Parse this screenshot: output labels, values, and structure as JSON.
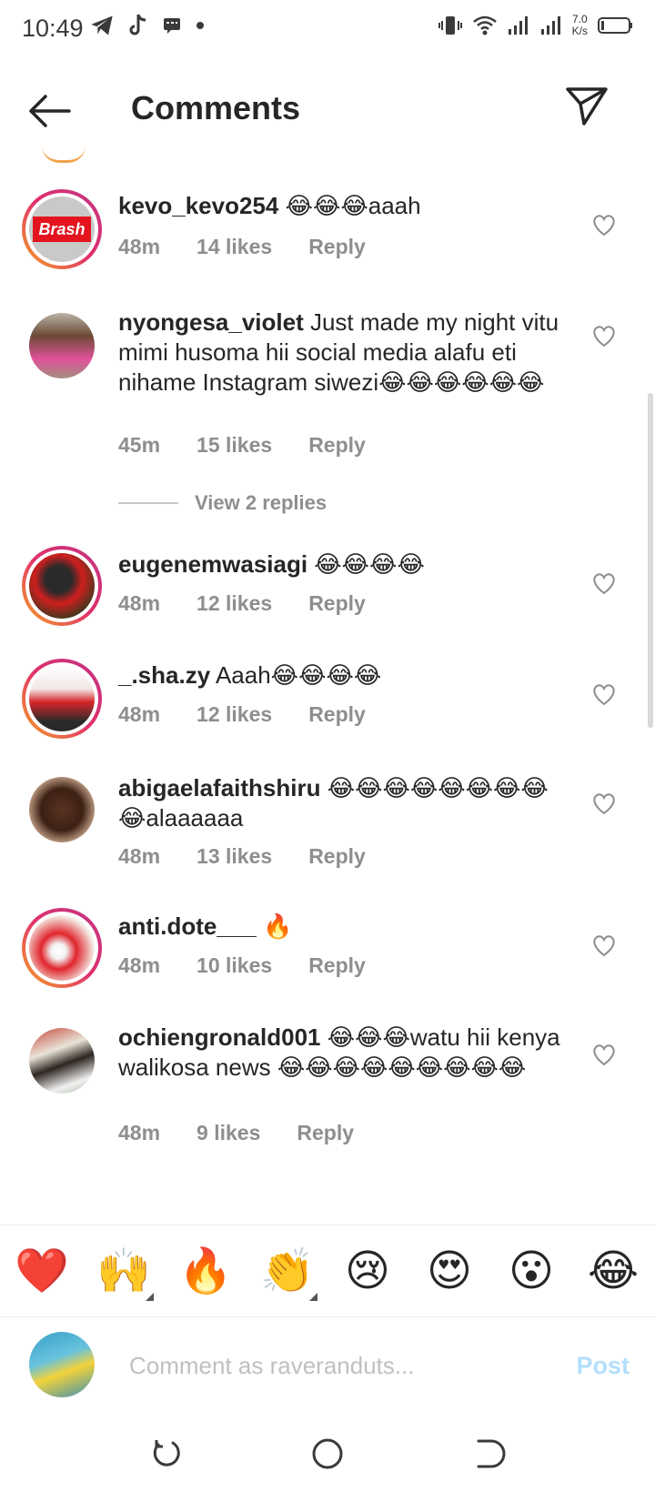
{
  "status_bar": {
    "time": "10:49",
    "left_icons": [
      "telegram-icon",
      "tiktok-icon",
      "message-icon",
      "dot-icon"
    ],
    "right_icons": [
      "vibrate-icon",
      "wifi-icon",
      "signal-icon",
      "signal-icon",
      "battery-icon"
    ],
    "speed_value": "7.0",
    "speed_unit": "K/s"
  },
  "header": {
    "title": "Comments",
    "back_icon": "arrow-left-icon",
    "share_icon": "paper-plane-icon"
  },
  "comments": [
    {
      "username": "kevo_kevo254",
      "text": " 😂😂😂aaah",
      "time": "48m",
      "likes": "14 likes",
      "reply": "Reply",
      "avatar_text": "Brash",
      "ring": true
    },
    {
      "username": "nyongesa_violet",
      "text": " Just made my night vitu mimi husoma hii social media alafu eti nihame Instagram siwezi😂😂😂😂😂😂",
      "time": "45m",
      "likes": "15 likes",
      "reply": "Reply",
      "ring": false
    },
    {
      "username": "eugenemwasiagi",
      "text": " 😂😂😂😂",
      "time": "48m",
      "likes": "12 likes",
      "reply": "Reply",
      "ring": true
    },
    {
      "username": "_.sha.zy",
      "text": " Aaah😂😂😂😂",
      "time": "48m",
      "likes": "12 likes",
      "reply": "Reply",
      "ring": true
    },
    {
      "username": "abigaelafaithshiru",
      "text": " 😂😂😂😂😂😂😂😂😂alaaaaaa",
      "time": "48m",
      "likes": "13 likes",
      "reply": "Reply",
      "ring": false
    },
    {
      "username": "anti.dote___",
      "text": " 🔥",
      "time": "48m",
      "likes": "10 likes",
      "reply": "Reply",
      "ring": true
    },
    {
      "username": "ochiengronald001",
      "text": " 😂😂😂watu hii kenya walikosa news 😂😂😂😂😂😂😂😂😂",
      "time": "48m",
      "likes": "9 likes",
      "reply": "Reply",
      "ring": false
    }
  ],
  "view_replies": "View 2 replies",
  "emoji_bar": [
    "❤️",
    "🙌",
    "🔥",
    "👏",
    "😢",
    "😍",
    "😮",
    "😂"
  ],
  "comment_input": {
    "placeholder": "Comment as raveranduts...",
    "post_label": "Post"
  },
  "nav_bar": [
    "rotate-icon",
    "home-icon",
    "back-nav-icon"
  ],
  "colors": {
    "accent_post": "#b2dffc",
    "ring_gradient": [
      "#f5a623",
      "#e1306c",
      "#c13584"
    ],
    "meta_gray": "#8e8e8e"
  }
}
